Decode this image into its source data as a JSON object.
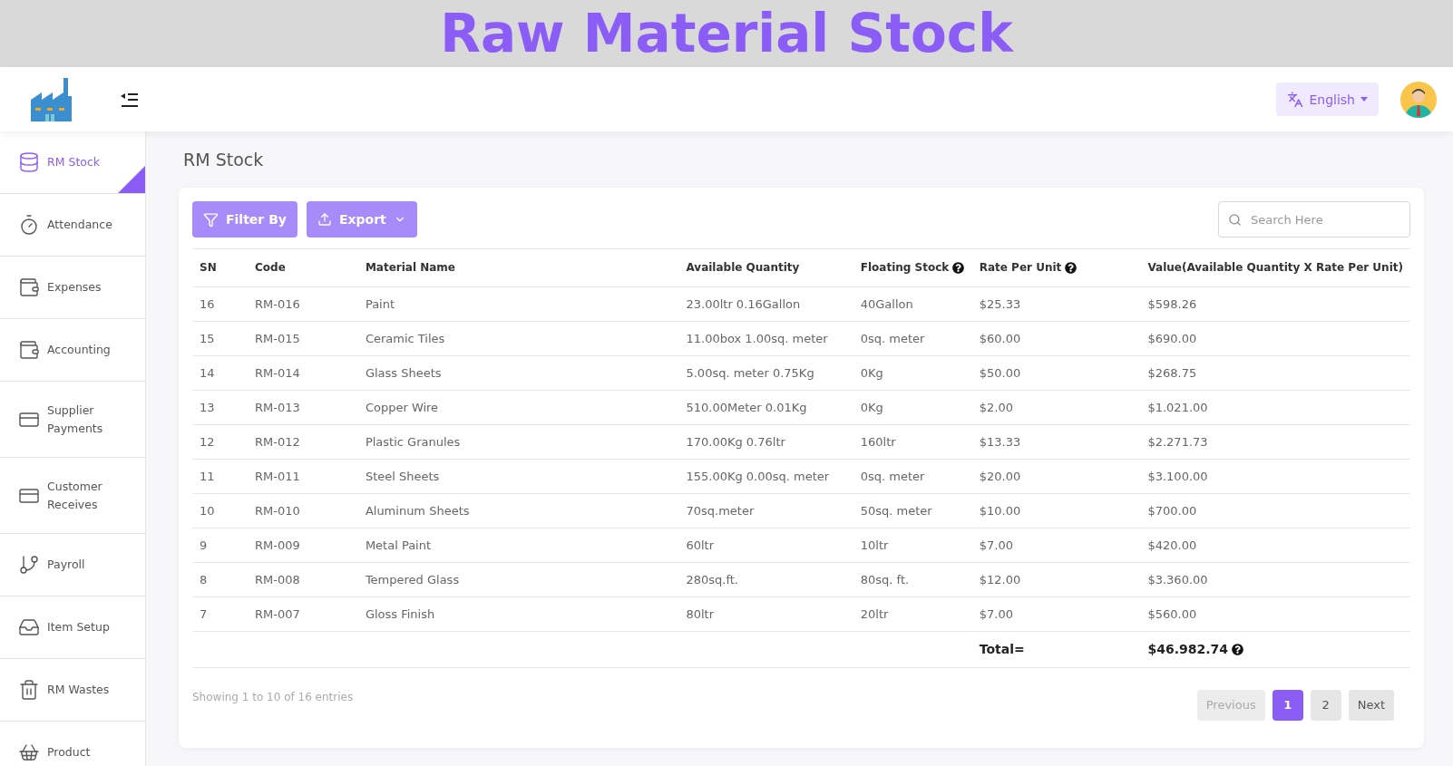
{
  "banner": {
    "title": "Raw Material Stock"
  },
  "header": {
    "language": "English"
  },
  "sidebar": {
    "items": [
      {
        "label": "RM Stock",
        "selected": true
      },
      {
        "label": "Attendance",
        "selected": false
      },
      {
        "label": "Expenses",
        "selected": false
      },
      {
        "label": "Accounting",
        "selected": false
      },
      {
        "label": "Supplier Payments",
        "selected": false
      },
      {
        "label": "Customer Receives",
        "selected": false
      },
      {
        "label": "Payroll",
        "selected": false
      },
      {
        "label": "Item Setup",
        "selected": false
      },
      {
        "label": "RM Wastes",
        "selected": false
      },
      {
        "label": "Product",
        "selected": false
      }
    ]
  },
  "page_title": "RM Stock",
  "toolbar": {
    "filter": "Filter By",
    "export": "Export",
    "search": {
      "placeholder": "Search Here"
    }
  },
  "table": {
    "columns": [
      {
        "label": "SN",
        "help": false
      },
      {
        "label": "Code",
        "help": false
      },
      {
        "label": "Material Name",
        "help": false
      },
      {
        "label": "Available Quantity",
        "help": false
      },
      {
        "label": "Floating Stock",
        "help": true
      },
      {
        "label": "Rate Per Unit",
        "help": true
      },
      {
        "label": "Value(Available Quantity X Rate Per Unit)",
        "help": false
      }
    ],
    "rows": [
      [
        "16",
        "RM-016",
        "Paint",
        "23.00ltr 0.16Gallon",
        "40Gallon",
        "$25.33",
        "$598.26"
      ],
      [
        "15",
        "RM-015",
        "Ceramic Tiles",
        "11.00box 1.00sq. meter",
        "0sq. meter",
        "$60.00",
        "$690.00"
      ],
      [
        "14",
        "RM-014",
        "Glass Sheets",
        "5.00sq. meter 0.75Kg",
        "0Kg",
        "$50.00",
        "$268.75"
      ],
      [
        "13",
        "RM-013",
        "Copper Wire",
        "510.00Meter 0.01Kg",
        "0Kg",
        "$2.00",
        "$1.021.00"
      ],
      [
        "12",
        "RM-012",
        "Plastic Granules",
        "170.00Kg 0.76ltr",
        "160ltr",
        "$13.33",
        "$2.271.73"
      ],
      [
        "11",
        "RM-011",
        "Steel Sheets",
        "155.00Kg 0.00sq. meter",
        "0sq. meter",
        "$20.00",
        "$3.100.00"
      ],
      [
        "10",
        "RM-010",
        "Aluminum Sheets",
        "70sq.meter",
        "50sq. meter",
        "$10.00",
        "$700.00"
      ],
      [
        "9",
        "RM-009",
        "Metal Paint",
        "60ltr",
        "10ltr",
        "$7.00",
        "$420.00"
      ],
      [
        "8",
        "RM-008",
        "Tempered Glass",
        "280sq.ft.",
        "80sq. ft.",
        "$12.00",
        "$3.360.00"
      ],
      [
        "7",
        "RM-007",
        "Gloss Finish",
        "80ltr",
        "20ltr",
        "$7.00",
        "$560.00"
      ]
    ],
    "total": {
      "label": "Total=",
      "value": "$46.982.74",
      "help": true
    }
  },
  "footer": {
    "info": "Showing 1 to 10 of 16 entries",
    "pagination": {
      "previous": {
        "label": "Previous",
        "disabled": true
      },
      "pages": [
        {
          "label": "1",
          "selected": true
        },
        {
          "label": "2",
          "selected": false
        }
      ],
      "next": {
        "label": "Next",
        "disabled": false
      }
    }
  }
}
